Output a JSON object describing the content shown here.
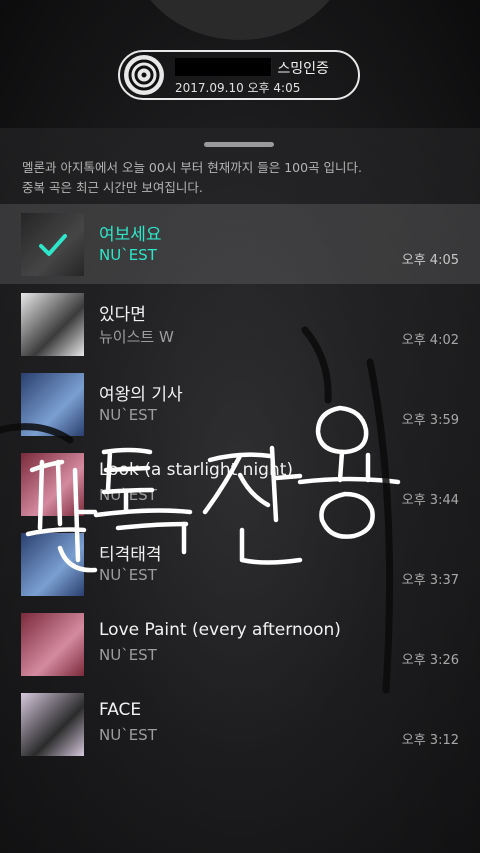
{
  "badge": {
    "title": "의 스밍인증",
    "date": "2017.09.10 오후 4:05"
  },
  "info": {
    "line1": "멜론과 아지톡에서 오늘 00시 부터 현재까지 들은 100곡 입니다.",
    "line2": "중복 곡은 최근 시간만 보여집니다."
  },
  "songs": [
    {
      "title": "여보세요",
      "artist": "NU`EST",
      "time": "오후 4:05",
      "selected": true,
      "art_colors": [
        "#3a3a3a",
        "#6b6b6b"
      ]
    },
    {
      "title": "있다면",
      "artist": "뉴이스트 W",
      "time": "오후 4:02",
      "selected": false,
      "art_colors": [
        "#e8e8e8",
        "#3b3b3b"
      ]
    },
    {
      "title": "여왕의 기사",
      "artist": "NU`EST",
      "time": "오후 3:59",
      "selected": false,
      "art_colors": [
        "#2a3f6e",
        "#7a9fd1"
      ]
    },
    {
      "title": "Look (a starlight night)",
      "artist": "NU`EST",
      "time": "오후 3:44",
      "selected": false,
      "art_colors": [
        "#7a2a3a",
        "#d48aa0"
      ]
    },
    {
      "title": "티격태격",
      "artist": "NU`EST",
      "time": "오후 3:37",
      "selected": false,
      "art_colors": [
        "#2a3f6e",
        "#7a9fd1"
      ]
    },
    {
      "title": "Love Paint (every afternoon)",
      "artist": "NU`EST",
      "time": "오후 3:26",
      "selected": false,
      "art_colors": [
        "#7a2a3a",
        "#d48aa0"
      ]
    },
    {
      "title": "FACE",
      "artist": "NU`EST",
      "time": "오후 3:12",
      "selected": false,
      "art_colors": [
        "#d6c9de",
        "#2b2b2b"
      ]
    }
  ],
  "overlay": {
    "handwriting": "판톡전용"
  },
  "colors": {
    "accent": "#2ee6c9"
  }
}
